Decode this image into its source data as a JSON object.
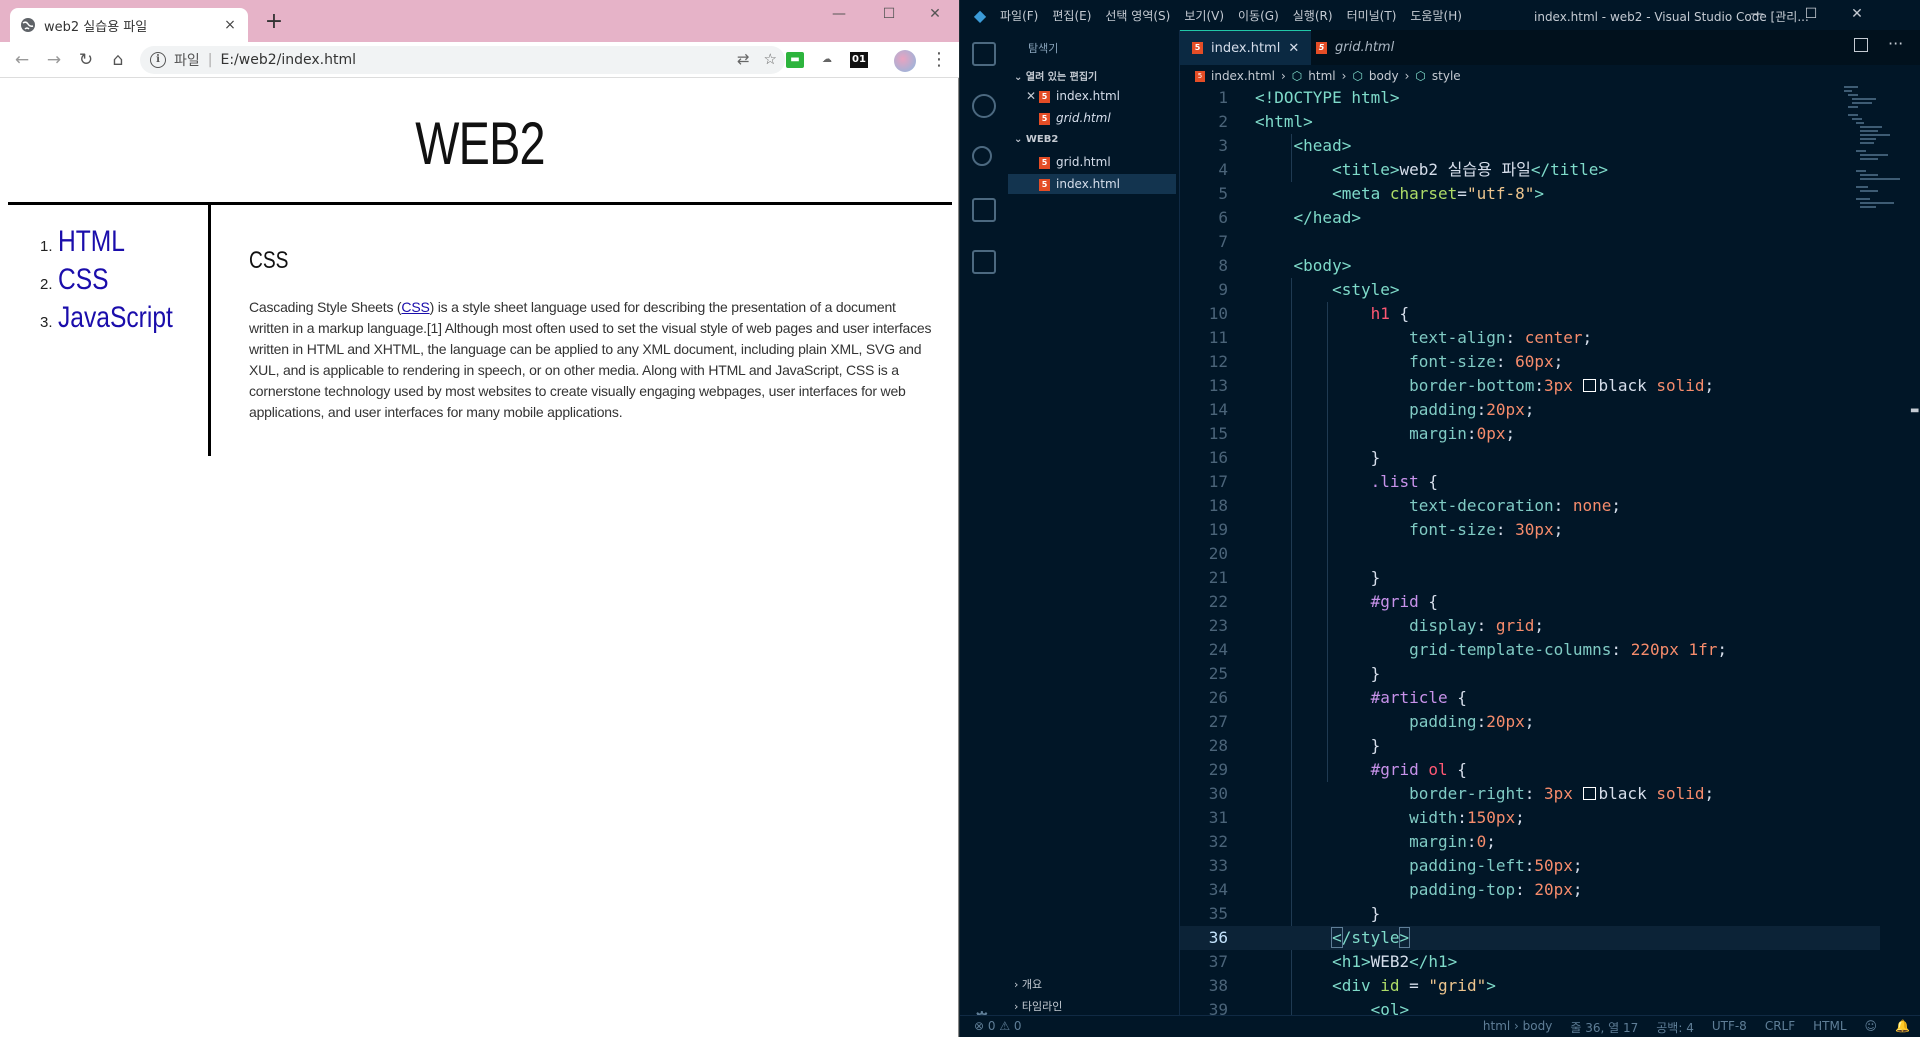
{
  "browser": {
    "tab_title": "web2 실습용 파일",
    "tab_close": "×",
    "new_tab": "+",
    "window_controls": [
      "—",
      "☐",
      "✕"
    ],
    "address_scheme": "파일",
    "address_url": "E:/web2/index.html",
    "ext_badge": "01",
    "page": {
      "heading": "WEB2",
      "nav": [
        {
          "num": "1.",
          "label": "HTML"
        },
        {
          "num": "2.",
          "label": "CSS"
        },
        {
          "num": "3.",
          "label": "JavaScript"
        }
      ],
      "article_title": "CSS",
      "article_prefix": "Cascading Style Sheets (",
      "article_link": "CSS",
      "article_suffix": ") is a style sheet language used for describing the presentation of a document written in a markup language.[1] Although most often used to set the visual style of web pages and user interfaces written in HTML and XHTML, the language can be applied to any XML document, including plain XML, SVG and XUL, and is applicable to rendering in speech, or on other media. Along with HTML and JavaScript, CSS is a cornerstone technology used by most websites to create visually engaging webpages, user interfaces for web applications, and user interfaces for many mobile applications."
    }
  },
  "vscode": {
    "menu": [
      "파일(F)",
      "편집(E)",
      "선택 영역(S)",
      "보기(V)",
      "이동(G)",
      "실행(R)",
      "터미널(T)",
      "도움말(H)"
    ],
    "window_title": "index.html - web2 - Visual Studio Code [관리...",
    "sidebar": {
      "title": "탐색기",
      "open_editors": "열려 있는 편집기",
      "open_files": [
        "index.html",
        "grid.html"
      ],
      "folder": "WEB2",
      "folder_files": [
        "grid.html",
        "index.html"
      ],
      "outline": "개요",
      "timeline": "타임라인"
    },
    "tabs": [
      "index.html",
      "grid.html"
    ],
    "breadcrumb": [
      "index.html",
      "html",
      "body",
      "style"
    ],
    "line_numbers": [
      "1",
      "2",
      "3",
      "4",
      "5",
      "6",
      "7",
      "8",
      "9",
      "10",
      "11",
      "12",
      "13",
      "14",
      "15",
      "16",
      "17",
      "18",
      "19",
      "20",
      "21",
      "22",
      "23",
      "24",
      "25",
      "26",
      "27",
      "28",
      "29",
      "30",
      "31",
      "32",
      "33",
      "34",
      "35",
      "36",
      "37",
      "38",
      "39"
    ],
    "current_line": 36,
    "status": {
      "problems": "⊗ 0 ⚠ 0",
      "path": "html › body",
      "position": "줄 36, 열 17",
      "spaces": "공백: 4",
      "encoding": "UTF-8",
      "eol": "CRLF",
      "language": "HTML"
    },
    "colors": {
      "bg": "#011627",
      "tag": "#7fdbca",
      "selector": "#c792ea",
      "property": "#80cbc4",
      "value": "#f78c6c",
      "string": "#ecc48d",
      "attr": "#addb67",
      "keyword": "#ff5874"
    }
  }
}
